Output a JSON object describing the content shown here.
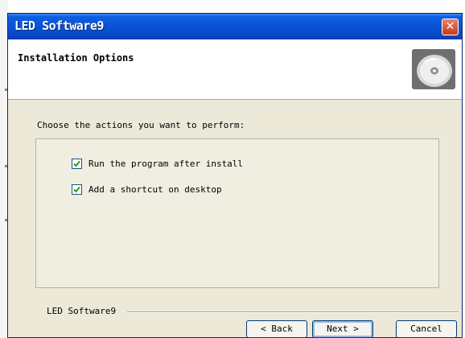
{
  "window": {
    "title": "LED Software9",
    "close_glyph": "✕"
  },
  "header": {
    "title": "Installation Options",
    "icon": "cd-disc-icon"
  },
  "main": {
    "prompt": "Choose the actions you want to perform:",
    "options": [
      {
        "label": "Run the program after install",
        "checked": true
      },
      {
        "label": "Add a shortcut on desktop",
        "checked": true
      }
    ]
  },
  "footer": {
    "brand": "LED Software9",
    "back_label": "< Back",
    "next_label": "Next >",
    "cancel_label": "Cancel"
  },
  "colors": {
    "titlebar": "#0a52d6",
    "dialog_bg": "#ece9d8",
    "close_button": "#c8391c"
  }
}
